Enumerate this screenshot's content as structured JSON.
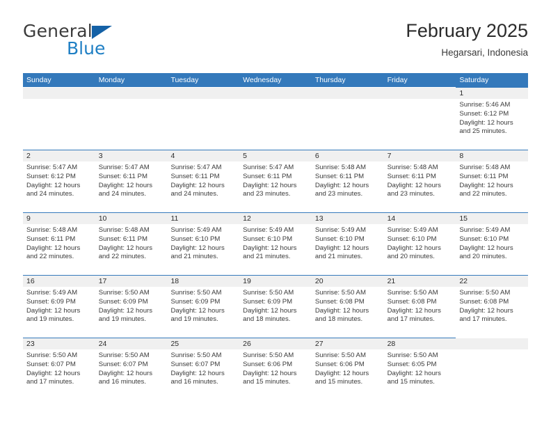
{
  "brand": {
    "word_one": "General",
    "word_two": "Blue",
    "flag_icon": "triangle-flag-icon",
    "accent_color": "#1461a6",
    "blue_text_color": "#1f7fc4"
  },
  "header": {
    "title": "February 2025",
    "subtitle": "Hegarsari, Indonesia"
  },
  "theme": {
    "header_bar_color": "#3479bb",
    "day_band_color": "#f0f0f0",
    "row_rule_color": "#3479bb"
  },
  "weekdays": [
    "Sunday",
    "Monday",
    "Tuesday",
    "Wednesday",
    "Thursday",
    "Friday",
    "Saturday"
  ],
  "labels": {
    "sunrise_prefix": "Sunrise:",
    "sunset_prefix": "Sunset:",
    "daylight_prefix": "Daylight:"
  },
  "weeks": [
    [
      {
        "empty": true
      },
      {
        "empty": true
      },
      {
        "empty": true
      },
      {
        "empty": true
      },
      {
        "empty": true
      },
      {
        "empty": true
      },
      {
        "empty": false,
        "day": "1",
        "sunrise": "Sunrise: 5:46 AM",
        "sunset": "Sunset: 6:12 PM",
        "daylight": "Daylight: 12 hours and 25 minutes."
      }
    ],
    [
      {
        "empty": false,
        "day": "2",
        "sunrise": "Sunrise: 5:47 AM",
        "sunset": "Sunset: 6:12 PM",
        "daylight": "Daylight: 12 hours and 24 minutes."
      },
      {
        "empty": false,
        "day": "3",
        "sunrise": "Sunrise: 5:47 AM",
        "sunset": "Sunset: 6:11 PM",
        "daylight": "Daylight: 12 hours and 24 minutes."
      },
      {
        "empty": false,
        "day": "4",
        "sunrise": "Sunrise: 5:47 AM",
        "sunset": "Sunset: 6:11 PM",
        "daylight": "Daylight: 12 hours and 24 minutes."
      },
      {
        "empty": false,
        "day": "5",
        "sunrise": "Sunrise: 5:47 AM",
        "sunset": "Sunset: 6:11 PM",
        "daylight": "Daylight: 12 hours and 23 minutes."
      },
      {
        "empty": false,
        "day": "6",
        "sunrise": "Sunrise: 5:48 AM",
        "sunset": "Sunset: 6:11 PM",
        "daylight": "Daylight: 12 hours and 23 minutes."
      },
      {
        "empty": false,
        "day": "7",
        "sunrise": "Sunrise: 5:48 AM",
        "sunset": "Sunset: 6:11 PM",
        "daylight": "Daylight: 12 hours and 23 minutes."
      },
      {
        "empty": false,
        "day": "8",
        "sunrise": "Sunrise: 5:48 AM",
        "sunset": "Sunset: 6:11 PM",
        "daylight": "Daylight: 12 hours and 22 minutes."
      }
    ],
    [
      {
        "empty": false,
        "day": "9",
        "sunrise": "Sunrise: 5:48 AM",
        "sunset": "Sunset: 6:11 PM",
        "daylight": "Daylight: 12 hours and 22 minutes."
      },
      {
        "empty": false,
        "day": "10",
        "sunrise": "Sunrise: 5:48 AM",
        "sunset": "Sunset: 6:11 PM",
        "daylight": "Daylight: 12 hours and 22 minutes."
      },
      {
        "empty": false,
        "day": "11",
        "sunrise": "Sunrise: 5:49 AM",
        "sunset": "Sunset: 6:10 PM",
        "daylight": "Daylight: 12 hours and 21 minutes."
      },
      {
        "empty": false,
        "day": "12",
        "sunrise": "Sunrise: 5:49 AM",
        "sunset": "Sunset: 6:10 PM",
        "daylight": "Daylight: 12 hours and 21 minutes."
      },
      {
        "empty": false,
        "day": "13",
        "sunrise": "Sunrise: 5:49 AM",
        "sunset": "Sunset: 6:10 PM",
        "daylight": "Daylight: 12 hours and 21 minutes."
      },
      {
        "empty": false,
        "day": "14",
        "sunrise": "Sunrise: 5:49 AM",
        "sunset": "Sunset: 6:10 PM",
        "daylight": "Daylight: 12 hours and 20 minutes."
      },
      {
        "empty": false,
        "day": "15",
        "sunrise": "Sunrise: 5:49 AM",
        "sunset": "Sunset: 6:10 PM",
        "daylight": "Daylight: 12 hours and 20 minutes."
      }
    ],
    [
      {
        "empty": false,
        "day": "16",
        "sunrise": "Sunrise: 5:49 AM",
        "sunset": "Sunset: 6:09 PM",
        "daylight": "Daylight: 12 hours and 19 minutes."
      },
      {
        "empty": false,
        "day": "17",
        "sunrise": "Sunrise: 5:50 AM",
        "sunset": "Sunset: 6:09 PM",
        "daylight": "Daylight: 12 hours and 19 minutes."
      },
      {
        "empty": false,
        "day": "18",
        "sunrise": "Sunrise: 5:50 AM",
        "sunset": "Sunset: 6:09 PM",
        "daylight": "Daylight: 12 hours and 19 minutes."
      },
      {
        "empty": false,
        "day": "19",
        "sunrise": "Sunrise: 5:50 AM",
        "sunset": "Sunset: 6:09 PM",
        "daylight": "Daylight: 12 hours and 18 minutes."
      },
      {
        "empty": false,
        "day": "20",
        "sunrise": "Sunrise: 5:50 AM",
        "sunset": "Sunset: 6:08 PM",
        "daylight": "Daylight: 12 hours and 18 minutes."
      },
      {
        "empty": false,
        "day": "21",
        "sunrise": "Sunrise: 5:50 AM",
        "sunset": "Sunset: 6:08 PM",
        "daylight": "Daylight: 12 hours and 17 minutes."
      },
      {
        "empty": false,
        "day": "22",
        "sunrise": "Sunrise: 5:50 AM",
        "sunset": "Sunset: 6:08 PM",
        "daylight": "Daylight: 12 hours and 17 minutes."
      }
    ],
    [
      {
        "empty": false,
        "day": "23",
        "sunrise": "Sunrise: 5:50 AM",
        "sunset": "Sunset: 6:07 PM",
        "daylight": "Daylight: 12 hours and 17 minutes."
      },
      {
        "empty": false,
        "day": "24",
        "sunrise": "Sunrise: 5:50 AM",
        "sunset": "Sunset: 6:07 PM",
        "daylight": "Daylight: 12 hours and 16 minutes."
      },
      {
        "empty": false,
        "day": "25",
        "sunrise": "Sunrise: 5:50 AM",
        "sunset": "Sunset: 6:07 PM",
        "daylight": "Daylight: 12 hours and 16 minutes."
      },
      {
        "empty": false,
        "day": "26",
        "sunrise": "Sunrise: 5:50 AM",
        "sunset": "Sunset: 6:06 PM",
        "daylight": "Daylight: 12 hours and 15 minutes."
      },
      {
        "empty": false,
        "day": "27",
        "sunrise": "Sunrise: 5:50 AM",
        "sunset": "Sunset: 6:06 PM",
        "daylight": "Daylight: 12 hours and 15 minutes."
      },
      {
        "empty": false,
        "day": "28",
        "sunrise": "Sunrise: 5:50 AM",
        "sunset": "Sunset: 6:05 PM",
        "daylight": "Daylight: 12 hours and 15 minutes."
      },
      {
        "empty": true
      }
    ]
  ]
}
